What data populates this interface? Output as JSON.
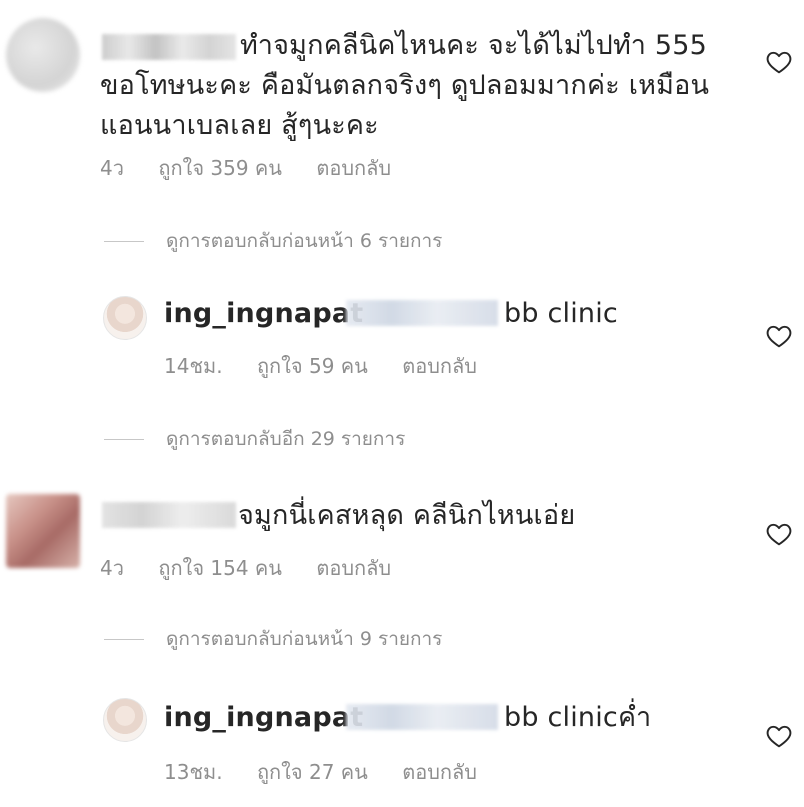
{
  "comments": [
    {
      "text_lines": [
        "ทำจมูกคลีนิคไหนคะ จะได้ไม่ไปทำ 555",
        "ขอโทษนะคะ คือมันตลกจริงๆ ดูปลอมมากค่ะ เหมือน",
        "แอนนาเบลเลย สู้ๆนะคะ"
      ],
      "time": "4ว",
      "likes": "ถูกใจ 359 คน",
      "reply_label": "ตอบกลับ",
      "view_replies": "ดูการตอบกลับก่อนหน้า 6 รายการ",
      "reply": {
        "username": "ing_ingnapat",
        "text": "bb clinic",
        "time": "14ชม.",
        "likes": "ถูกใจ 59 คน",
        "reply_label": "ตอบกลับ"
      },
      "more_replies": "ดูการตอบกลับอีก 29 รายการ"
    },
    {
      "text_lines": [
        "จมูกนี่เคสหลุด คลีนิกไหนเอ่ย"
      ],
      "time": "4ว",
      "likes": "ถูกใจ 154 คน",
      "reply_label": "ตอบกลับ",
      "view_replies": "ดูการตอบกลับก่อนหน้า 9 รายการ",
      "reply": {
        "username": "ing_ingnapat",
        "text": "bb clinicค่ำ",
        "time": "13ชม.",
        "likes": "ถูกใจ 27 คน",
        "reply_label": "ตอบกลับ"
      }
    }
  ],
  "icons": {
    "like": "heart-outline-icon"
  },
  "colors": {
    "text": "#262626",
    "meta": "#8e8e8e",
    "divider": "#c7c7c7",
    "background": "#ffffff"
  }
}
